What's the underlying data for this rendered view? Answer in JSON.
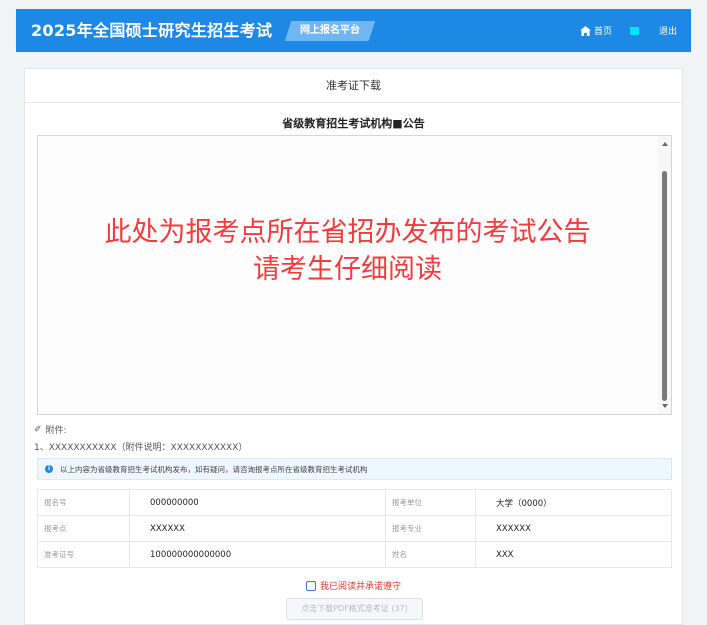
{
  "header": {
    "title": "2025年全国硕士研究生招生考试",
    "platform_tag": "网上报名平台",
    "nav_home": "首页",
    "nav_logout": "退出",
    "accent_color": "#1e88e5"
  },
  "panel": {
    "title": "准考证下载",
    "notice_title": "省级教育招生考试机构■公告",
    "notice_body_line1": "此处为报考点所在省招办发布的考试公告",
    "notice_body_line2": "请考生仔细阅读",
    "attachment_label": "附件:",
    "attachment_item": "1、XXXXXXXXXXX（附件说明：XXXXXXXXXXX）",
    "info_banner": "以上内容为省级教育招生考试机构发布，如有疑问，请咨询报考点所在省级教育招生考试机构"
  },
  "candidate": {
    "rows": [
      {
        "label1": "报名号",
        "value1": "000000000",
        "label2": "报考单位",
        "value2": "大学（0000）"
      },
      {
        "label1": "报考点",
        "value1": "XXXXXX",
        "label2": "报考专业",
        "value2": "XXXXXX"
      },
      {
        "label1": "准考证号",
        "value1": "100000000000000",
        "label2": "姓名",
        "value2": "XXX"
      }
    ]
  },
  "actions": {
    "agree_label": "我已阅读并承诺遵守",
    "download_button": "点击下载PDF格式准考证 (37)"
  }
}
